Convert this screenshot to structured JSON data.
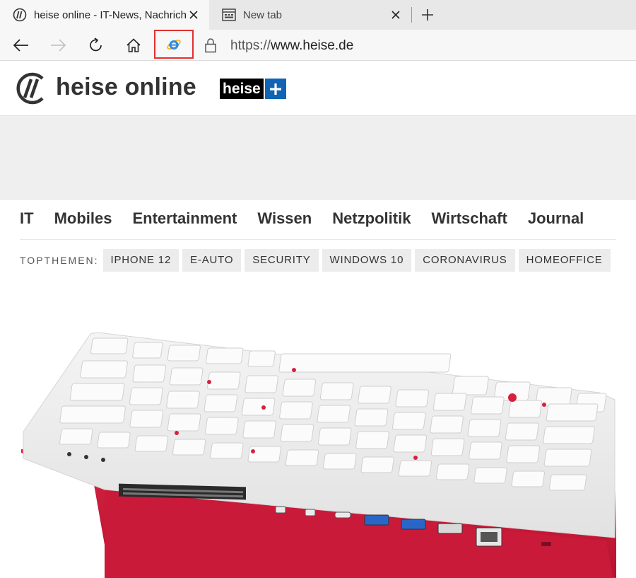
{
  "browser": {
    "tabs": [
      {
        "title": "heise online - IT-News, Nachricht",
        "active": true,
        "icon": "heise-favicon"
      },
      {
        "title": "New tab",
        "active": false,
        "icon": "new-tab-page-icon"
      }
    ],
    "address": {
      "protocol": "https://",
      "host": "www.heise.de"
    },
    "highlight_color": "#e0312f"
  },
  "site": {
    "logo_text": "heise online",
    "plus_badge_text": "heise",
    "nav_items": [
      "IT",
      "Mobiles",
      "Entertainment",
      "Wissen",
      "Netzpolitik",
      "Wirtschaft",
      "Journal"
    ],
    "topthemen_label": "TOPTHEMEN:",
    "topthemen": [
      "IPHONE 12",
      "E-AUTO",
      "SECURITY",
      "WINDOWS 10",
      "CORONAVIRUS",
      "HOMEOFFICE"
    ],
    "accent_color": "#1164b4"
  },
  "hero": {
    "image": "raspberry-pi-400-keyboard"
  }
}
